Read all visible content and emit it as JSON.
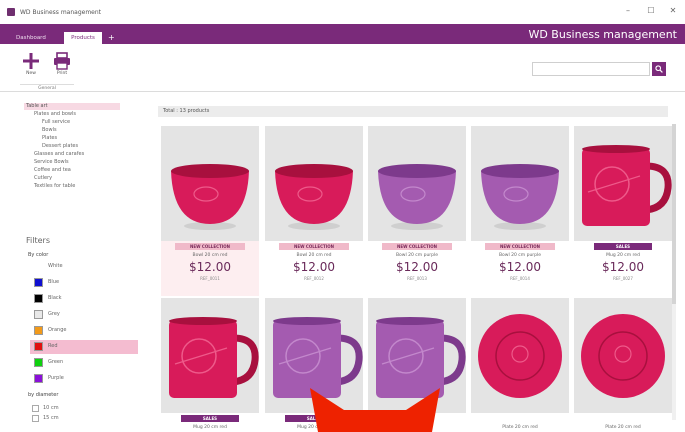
{
  "window": {
    "title": "WD Business management",
    "controls": [
      "–",
      "☐",
      "✕"
    ]
  },
  "tabs": {
    "items": [
      "Dashboard",
      "Products"
    ],
    "active": 1,
    "add_label": "+"
  },
  "brand": "WD Business management",
  "ribbon": {
    "new_label": "New",
    "print_label": "Print",
    "group_label": "General",
    "search_placeholder": "",
    "search_icon": "search-icon"
  },
  "sidebar": {
    "categories": [
      {
        "label": "Table art",
        "level": 0,
        "selected": true
      },
      {
        "label": "Plates and bowls",
        "level": 1
      },
      {
        "label": "Full service",
        "level": 2
      },
      {
        "label": "Bowls",
        "level": 2
      },
      {
        "label": "Plates",
        "level": 2
      },
      {
        "label": "Dessert plates",
        "level": 2
      },
      {
        "label": "Glasses and carafes",
        "level": 1
      },
      {
        "label": "Service Bowls",
        "level": 1
      },
      {
        "label": "Coffee and tea",
        "level": 1
      },
      {
        "label": "Cutlery",
        "level": 1
      },
      {
        "label": "Textiles for table",
        "level": 1
      }
    ],
    "filters_title": "Filters",
    "by_color_label": "By color",
    "colors": [
      {
        "name": "White",
        "hex": "#ffffff",
        "show_swatch": false
      },
      {
        "name": "Blue",
        "hex": "#1010d0"
      },
      {
        "name": "Black",
        "hex": "#000000"
      },
      {
        "name": "Grey",
        "hex": "#e8e8e8"
      },
      {
        "name": "Orange",
        "hex": "#f29a1a"
      },
      {
        "name": "Red",
        "hex": "#e01010",
        "selected": true
      },
      {
        "name": "Green",
        "hex": "#10d010"
      },
      {
        "name": "Purple",
        "hex": "#8a10d8"
      }
    ],
    "by_diameter_label": "by diameter",
    "diameters": [
      "10 cm",
      "15 cm"
    ]
  },
  "grid": {
    "total_label": "Total : 13 products",
    "products": [
      {
        "badge": "NEW COLLECTION",
        "badge_type": "new",
        "name": "Bowl 20 cm red",
        "price": "$12.00",
        "ref": "REF_0011",
        "image": "bowl-red",
        "highlight": true
      },
      {
        "badge": "NEW COLLECTION",
        "badge_type": "new",
        "name": "Bowl 20 cm red",
        "price": "$12.00",
        "ref": "REF_0012",
        "image": "bowl-red"
      },
      {
        "badge": "NEW COLLECTION",
        "badge_type": "new",
        "name": "Bowl 20 cm purple",
        "price": "$12.00",
        "ref": "REF_0013",
        "image": "bowl-purple"
      },
      {
        "badge": "NEW COLLECTION",
        "badge_type": "new",
        "name": "Bowl 20 cm purple",
        "price": "$12.00",
        "ref": "REF_0014",
        "image": "bowl-purple"
      },
      {
        "badge": "SALES",
        "badge_type": "sold",
        "name": "Mug 20 cm red",
        "price": "$12.00",
        "ref": "REF_0027",
        "image": "mug-red"
      },
      {
        "badge": "SALES",
        "badge_type": "sold",
        "name": "Mug 20 cm red",
        "price": "",
        "ref": "",
        "image": "mug-red"
      },
      {
        "badge": "SALES",
        "badge_type": "sold",
        "name": "Mug 20 cm red",
        "price": "",
        "ref": "",
        "image": "mug-purple"
      },
      {
        "badge": "",
        "badge_type": "none",
        "name": "",
        "price": "",
        "ref": "",
        "image": "mug-purple"
      },
      {
        "badge": "",
        "badge_type": "none",
        "name": "Plate 20 cm red",
        "price": "",
        "ref": "",
        "image": "plate-red"
      },
      {
        "badge": "",
        "badge_type": "none",
        "name": "Plate 20 cm red",
        "price": "",
        "ref": "",
        "image": "plate-red"
      }
    ]
  },
  "overlay": {
    "color": "#ee2200",
    "icon": "red-cat-ears-overlay"
  }
}
